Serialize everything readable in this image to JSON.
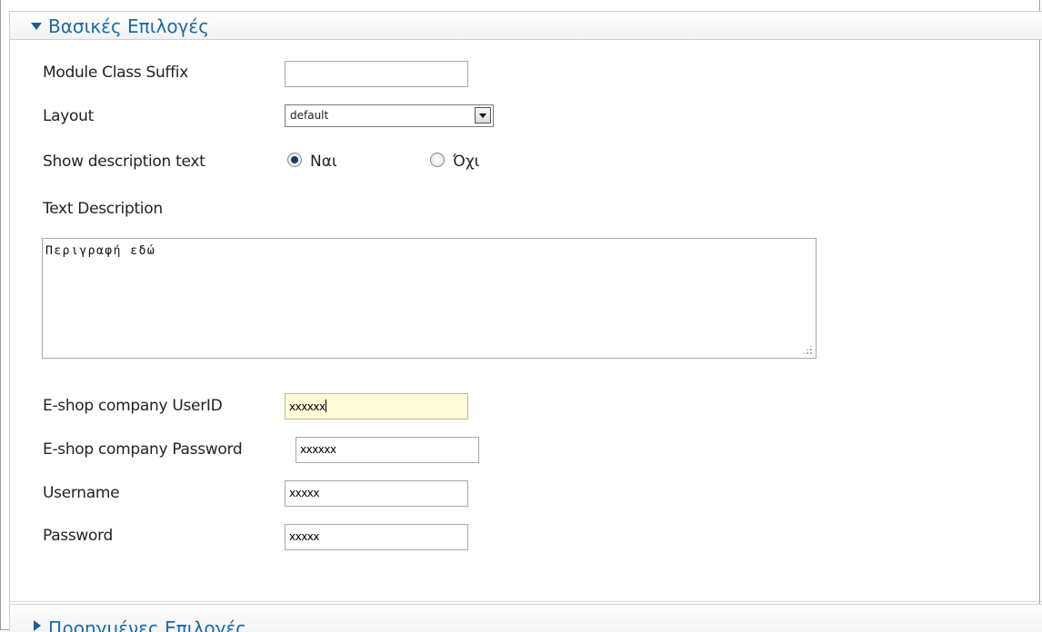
{
  "panels": {
    "basic": {
      "title": "Βασικές Επιλογές",
      "expanded": true
    },
    "advanced": {
      "title": "Προηγμένες Επιλογές",
      "expanded": false
    }
  },
  "fields": {
    "module_class_suffix": {
      "label": "Module Class Suffix",
      "value": ""
    },
    "layout": {
      "label": "Layout",
      "value": "default"
    },
    "show_description": {
      "label": "Show description text",
      "option_yes": "Ναι",
      "option_no": "Όχι",
      "selected": "yes"
    },
    "text_description": {
      "label": "Text Description",
      "value": "Περιγραφή εδώ"
    },
    "eshop_userid": {
      "label": "E-shop company UserID",
      "value": "xxxxxx"
    },
    "eshop_password": {
      "label": "E-shop company Password",
      "value": "xxxxxx"
    },
    "username": {
      "label": "Username",
      "value": "xxxxx"
    },
    "password": {
      "label": "Password",
      "value": "xxxxx"
    }
  },
  "colors": {
    "accent": "#1b6aa6",
    "focus_bg": "#fffcd6"
  },
  "icons": {
    "expanded": "triangle-down-icon",
    "collapsed": "triangle-right-icon"
  }
}
